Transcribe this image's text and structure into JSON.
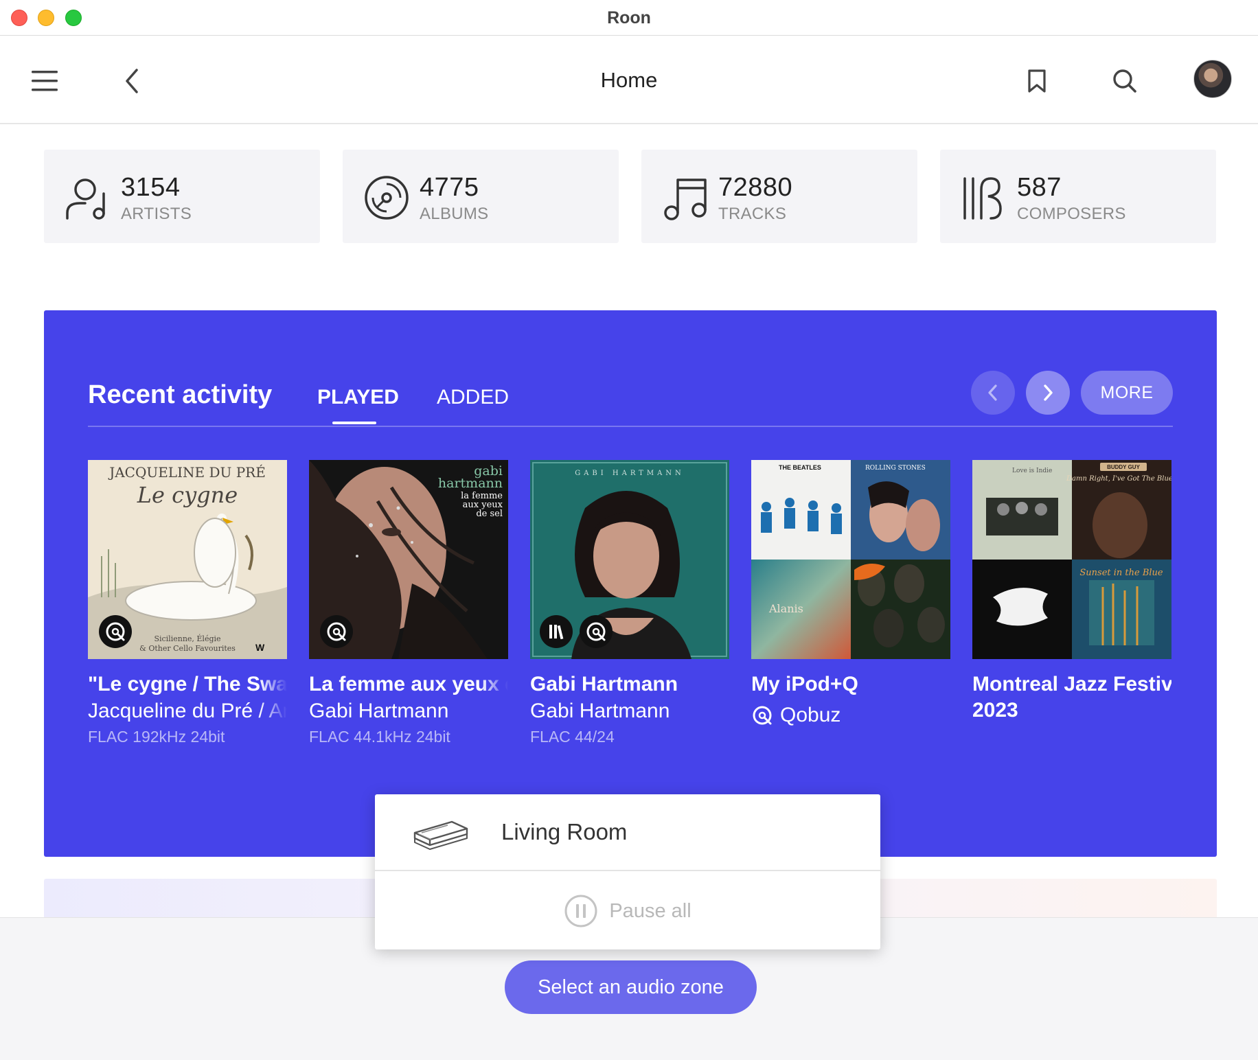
{
  "window": {
    "title": "Roon"
  },
  "header": {
    "page_title": "Home"
  },
  "stats": [
    {
      "value": "3154",
      "label": "ARTISTS",
      "icon": "artist-icon"
    },
    {
      "value": "4775",
      "label": "ALBUMS",
      "icon": "album-icon"
    },
    {
      "value": "72880",
      "label": "TRACKS",
      "icon": "music-note-icon"
    },
    {
      "value": "587",
      "label": "COMPOSERS",
      "icon": "composer-icon"
    }
  ],
  "recent": {
    "title": "Recent activity",
    "tabs": [
      {
        "label": "PLAYED",
        "active": true
      },
      {
        "label": "ADDED",
        "active": false
      }
    ],
    "more_label": "MORE",
    "items": [
      {
        "title": "\"Le cygne / The Swan\"",
        "subtitle": "Jacqueline du Pré / Ar",
        "meta": "FLAC 192kHz 24bit",
        "cover_text": {
          "top": "JACQUELINE DU PRÉ",
          "script": "Le cygne",
          "bottom1": "Sicilienne, Élégie",
          "bottom2": "& Other Cello Favourites"
        }
      },
      {
        "title": "La femme aux yeux de",
        "subtitle": "Gabi Hartmann",
        "meta": "FLAC 44.1kHz 24bit",
        "cover_text": {
          "top1": "gabi",
          "top2": "hartmann",
          "sub1": "la femme",
          "sub2": "aux yeux",
          "sub3": "de sel"
        }
      },
      {
        "title": "Gabi Hartmann",
        "subtitle": "Gabi Hartmann",
        "meta": "FLAC 44/24",
        "cover_text": {
          "top": "GABI HARTMANN"
        }
      },
      {
        "title": "My iPod+Q",
        "source": "Qobuz",
        "cover_text": {
          "q1": "THE BEATLES",
          "q2": "ROLLING STONES",
          "q3": "Alanis"
        }
      },
      {
        "title": "Montreal Jazz Festival",
        "title2": "2023",
        "cover_text": {
          "q1": "Love is Indie",
          "q2": "BUDDY GUY",
          "q2b": "Damn Right, I've Got The Blues",
          "q4": "Sunset in the Blue"
        }
      }
    ]
  },
  "zone_popup": {
    "zone_name": "Living Room",
    "pause_label": "Pause all"
  },
  "bottom": {
    "select_zone_label": "Select an audio zone"
  },
  "colors": {
    "accent": "#4643ea",
    "zone_button": "#6b69ec"
  }
}
